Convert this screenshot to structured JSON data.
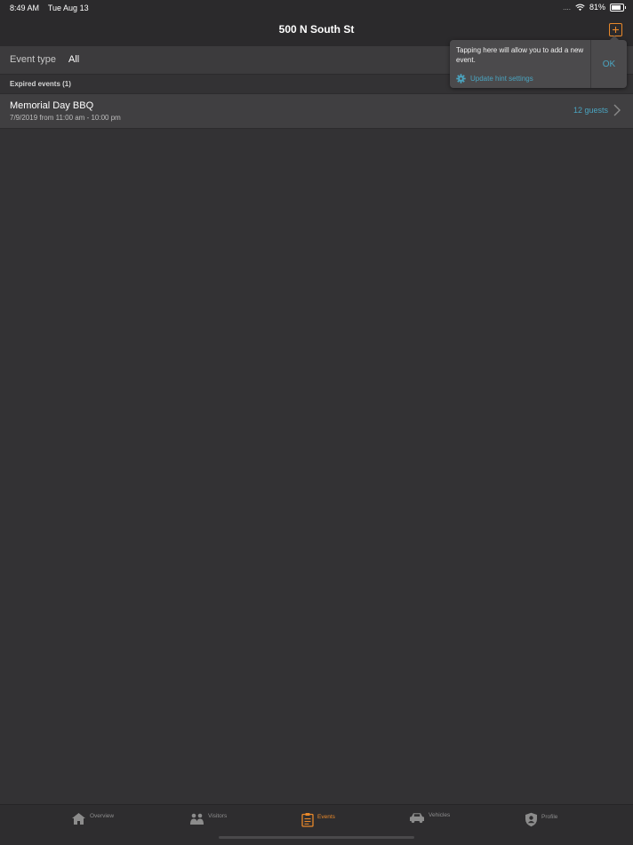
{
  "status_bar": {
    "time": "8:49 AM",
    "date": "Tue Aug 13",
    "signal": "....",
    "battery": "81%",
    "battery_level": 0.81
  },
  "nav": {
    "title": "500 N South St"
  },
  "filter": {
    "label": "Event type",
    "value": "All"
  },
  "section": {
    "header": "Expired events (1)"
  },
  "events": [
    {
      "title": "Memorial Day BBQ",
      "time": "7/9/2019 from 11:00 am - 10:00 pm",
      "guests": "12 guests"
    }
  ],
  "tooltip": {
    "text": "Tapping here will allow you to add a new event.",
    "link": "Update hint settings",
    "ok": "OK"
  },
  "tabs": [
    {
      "label": "Overview",
      "icon": "house-icon",
      "active": false
    },
    {
      "label": "Visitors",
      "icon": "visitors-icon",
      "active": false
    },
    {
      "label": "Events",
      "icon": "clipboard-icon",
      "active": true
    },
    {
      "label": "Vehicles",
      "icon": "car-icon",
      "active": false
    },
    {
      "label": "Profile",
      "icon": "shield-user-icon",
      "active": false
    }
  ],
  "colors": {
    "accent": "#e8882a",
    "link": "#4aa4c0",
    "background": "#333234"
  }
}
